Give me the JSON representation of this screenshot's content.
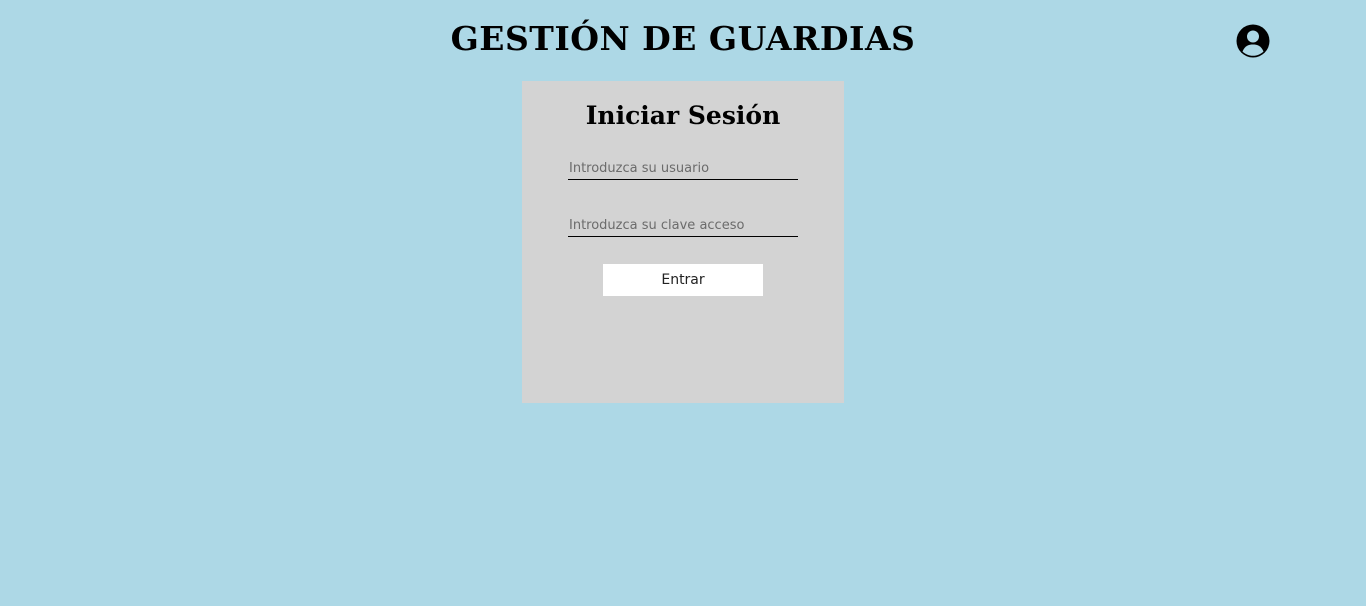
{
  "header": {
    "title": "GESTIÓN DE GUARDIAS",
    "user_icon": "user-circle-icon"
  },
  "login": {
    "title": "Iniciar Sesión",
    "username": {
      "value": "",
      "placeholder": "Introduzca su usuario"
    },
    "password": {
      "value": "",
      "placeholder": "Introduzca su clave acceso"
    },
    "submit_label": "Entrar"
  },
  "colors": {
    "background": "#add8e6",
    "card": "#d3d3d3",
    "button": "#ffffff"
  }
}
